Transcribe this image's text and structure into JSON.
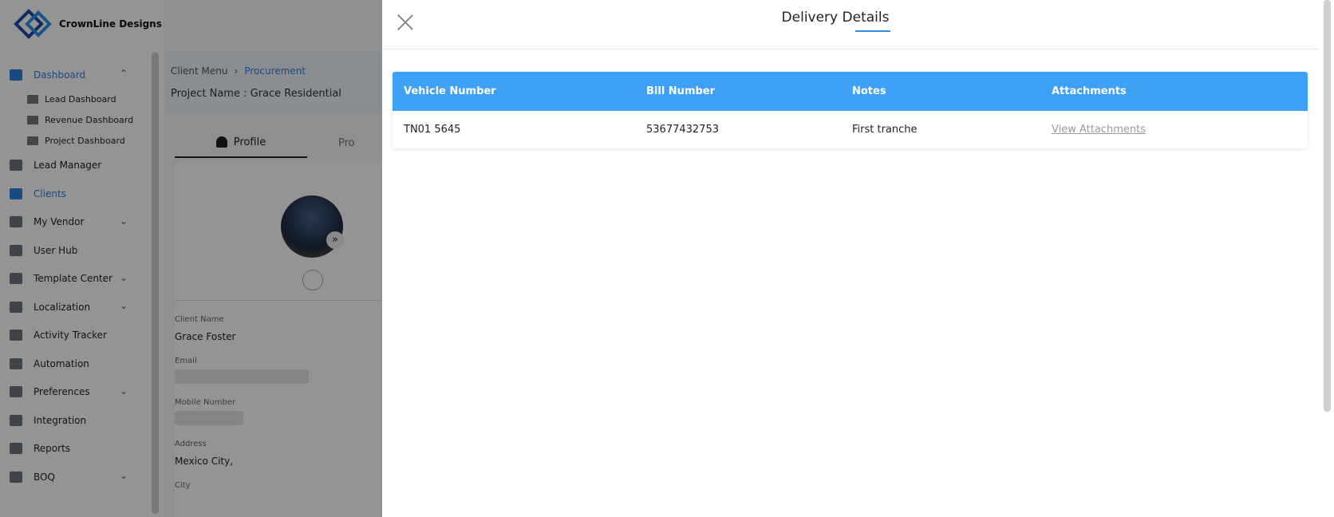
{
  "brand": {
    "name": "CrownLine Designs"
  },
  "sidebar": {
    "items": [
      {
        "label": "Dashboard",
        "icon": "dashboard-icon",
        "expanded": true,
        "children": [
          {
            "label": "Lead Dashboard",
            "icon": "chart-icon"
          },
          {
            "label": "Revenue Dashboard",
            "icon": "chart-icon"
          },
          {
            "label": "Project Dashboard",
            "icon": "chart-icon"
          }
        ]
      },
      {
        "label": "Lead Manager",
        "icon": "lead-icon"
      },
      {
        "label": "Clients",
        "icon": "clients-icon",
        "active": true
      },
      {
        "label": "My Vendor",
        "icon": "vendor-icon",
        "expandable": true
      },
      {
        "label": "User Hub",
        "icon": "user-icon"
      },
      {
        "label": "Template Center",
        "icon": "template-icon",
        "expandable": true
      },
      {
        "label": "Localization",
        "icon": "localization-icon",
        "expandable": true
      },
      {
        "label": "Activity Tracker",
        "icon": "activity-icon"
      },
      {
        "label": "Automation",
        "icon": "automation-icon"
      },
      {
        "label": "Preferences",
        "icon": "preferences-icon",
        "expandable": true
      },
      {
        "label": "Integration",
        "icon": "integration-icon"
      },
      {
        "label": "Reports",
        "icon": "reports-icon"
      },
      {
        "label": "BOQ",
        "icon": "boq-icon",
        "expandable": true
      }
    ]
  },
  "page": {
    "breadcrumb": [
      "Client Menu",
      "Procurement"
    ],
    "project_label": "Project Name :",
    "project_name": "Grace Residential",
    "tabs": [
      "Profile",
      "Pro"
    ],
    "fields": [
      {
        "label": "Client Name",
        "value": "Grace Foster"
      },
      {
        "label": "Email",
        "value": ""
      },
      {
        "label": "Mobile Number",
        "value": ""
      },
      {
        "label": "Address",
        "value": "Mexico City,"
      },
      {
        "label": "City",
        "value": ""
      }
    ]
  },
  "drawer": {
    "title": "Delivery Details",
    "columns": [
      "Vehicle Number",
      "Bill Number",
      "Notes",
      "Attachments"
    ],
    "rows": [
      {
        "vehicle_number": "TN01 5645",
        "bill_number": "53677432753",
        "notes": "First tranche",
        "attachments_link": "View Attachments"
      }
    ]
  },
  "colors": {
    "accent": "#3fa0f8",
    "active_nav": "#2f7fe0"
  }
}
